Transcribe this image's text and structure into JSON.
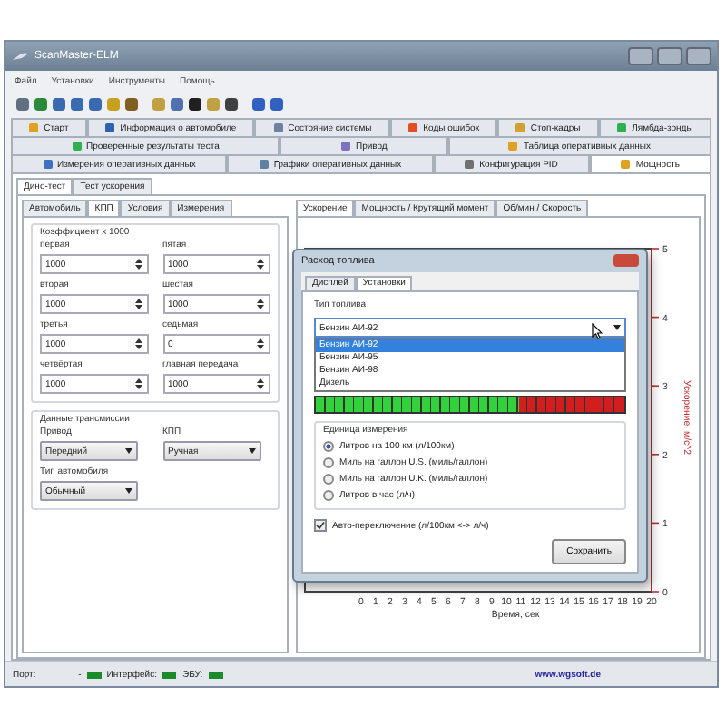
{
  "window": {
    "title": "ScanMaster-ELM"
  },
  "menu": [
    "Файл",
    "Установки",
    "Инструменты",
    "Помощь"
  ],
  "tab_rows": [
    {
      "tabs": [
        {
          "label": "Старт",
          "selected": false
        },
        {
          "label": "Информация о автомобиле",
          "selected": false
        },
        {
          "label": "Состояние системы",
          "selected": false
        },
        {
          "label": "Коды ошибок",
          "selected": false
        },
        {
          "label": "Стоп-кадры",
          "selected": false
        },
        {
          "label": "Лямбда-зонды",
          "selected": false
        }
      ]
    },
    {
      "tabs": [
        {
          "label": "Проверенные результаты теста",
          "selected": false
        },
        {
          "label": "Привод",
          "selected": false
        },
        {
          "label": "Таблица оперативных данных",
          "selected": false
        }
      ]
    },
    {
      "tabs": [
        {
          "label": "Измерения оперативных данных",
          "selected": false
        },
        {
          "label": "Графики оперативных данных",
          "selected": false
        },
        {
          "label": "Конфигурация PID",
          "selected": false
        },
        {
          "label": "Мощность",
          "selected": true
        }
      ]
    }
  ],
  "sub_tabs": [
    {
      "label": "Дино-тест",
      "selected": true
    },
    {
      "label": "Тест ускорения",
      "selected": false
    }
  ],
  "left_tabs": [
    {
      "label": "Автомобиль",
      "selected": false
    },
    {
      "label": "КПП",
      "selected": true
    },
    {
      "label": "Условия",
      "selected": false
    },
    {
      "label": "Измерения",
      "selected": false
    }
  ],
  "ratios": {
    "title": "Коэффициент x 1000",
    "fields": [
      {
        "label": "первая",
        "value": "1000"
      },
      {
        "label": "пятая",
        "value": "1000"
      },
      {
        "label": "вторая",
        "value": "1000"
      },
      {
        "label": "шестая",
        "value": "1000"
      },
      {
        "label": "третья",
        "value": "1000"
      },
      {
        "label": "седьмая",
        "value": "0"
      },
      {
        "label": "четвёртая",
        "value": "1000"
      },
      {
        "label": "главная передача",
        "value": "1000"
      }
    ]
  },
  "transmission": {
    "title": "Данные трансмиссии",
    "selects": [
      {
        "label": "Привод",
        "value": "Передний"
      },
      {
        "label": "КПП",
        "value": "Ручная"
      }
    ],
    "car_type": {
      "label": "Тип автомобиля",
      "value": "Обычный"
    }
  },
  "chart_tabs": [
    {
      "label": "Ускорение",
      "selected": true
    },
    {
      "label": "Мощность / Крутящий момент",
      "selected": false
    },
    {
      "label": "Об/мин / Скорость",
      "selected": false
    }
  ],
  "chart": {
    "xlabel": "Время, сек",
    "ylabel": "Ускорение, м/с^2",
    "x_ticks": [
      "0",
      "1",
      "2",
      "3",
      "4",
      "5",
      "6",
      "7",
      "8",
      "9",
      "10",
      "11",
      "12",
      "13",
      "14",
      "15",
      "16",
      "17",
      "18",
      "19",
      "20"
    ],
    "y_ticks": [
      "5",
      "4",
      "3",
      "2",
      "1",
      "0"
    ]
  },
  "dialog": {
    "title": "Расход топлива",
    "tabs": [
      {
        "label": "Дисплей",
        "selected": false
      },
      {
        "label": "Установки",
        "selected": true
      }
    ],
    "fuel_label": "Тип топлива",
    "fuel_value": "Бензин АИ-92",
    "fuel_options": [
      {
        "label": "Бензин АИ-92",
        "selected": true
      },
      {
        "label": "Бензин АИ-95",
        "selected": false
      },
      {
        "label": "Бензин АИ-98",
        "selected": false
      },
      {
        "label": "Дизель",
        "selected": false
      }
    ],
    "meter": {
      "level": 0.66
    },
    "units_title": "Единица измерения",
    "units": [
      {
        "label": "Литров на 100 км (л/100км)",
        "selected": true
      },
      {
        "label": "Миль на галлон U.S. (миль/галлон)",
        "selected": false
      },
      {
        "label": "Миль на галлон U.K. (миль/галлон)",
        "selected": false
      },
      {
        "label": "Литров в час (л/ч)",
        "selected": false
      }
    ],
    "auto_switch": {
      "label": "Авто-переключение (л/100км <-> л/ч)",
      "checked": true
    },
    "save_button": "Сохранить"
  },
  "status_bar": {
    "port_label": "Порт:",
    "port_value": "-",
    "interface_label": "Интерфейс:",
    "ecu_label": "ЭБУ:",
    "website": "www.wgsoft.de"
  }
}
